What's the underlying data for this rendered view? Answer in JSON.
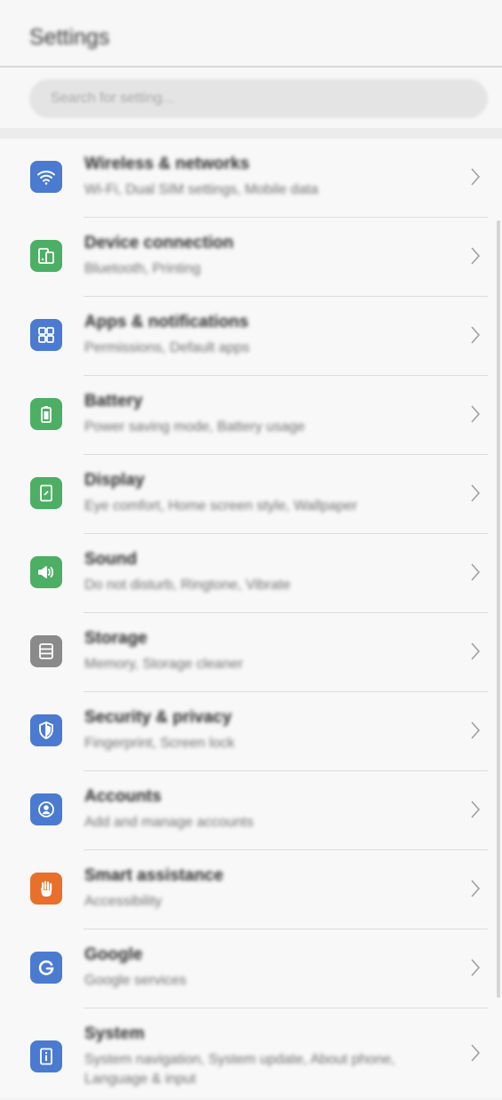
{
  "header": {
    "title": "Settings"
  },
  "search": {
    "placeholder": "Search for setting..."
  },
  "items": [
    {
      "label": "Wireless & networks",
      "sub": "Wi-Fi, Dual SIM settings, Mobile data",
      "icon": "wifi-icon",
      "color": "#4a7bd0"
    },
    {
      "label": "Device connection",
      "sub": "Bluetooth, Printing",
      "icon": "device-connection-icon",
      "color": "#4caf64"
    },
    {
      "label": "Apps & notifications",
      "sub": "Permissions, Default apps",
      "icon": "apps-grid-icon",
      "color": "#4a7bd0"
    },
    {
      "label": "Battery",
      "sub": "Power saving mode, Battery usage",
      "icon": "battery-icon",
      "color": "#4caf64"
    },
    {
      "label": "Display",
      "sub": "Eye comfort, Home screen style, Wallpaper",
      "icon": "display-icon",
      "color": "#4caf64"
    },
    {
      "label": "Sound",
      "sub": "Do not disturb, Ringtone, Vibrate",
      "icon": "speaker-icon",
      "color": "#4caf64"
    },
    {
      "label": "Storage",
      "sub": "Memory, Storage cleaner",
      "icon": "storage-icon",
      "color": "#8a8a8a"
    },
    {
      "label": "Security & privacy",
      "sub": "Fingerprint, Screen lock",
      "icon": "shield-icon",
      "color": "#4a7bd0"
    },
    {
      "label": "Accounts",
      "sub": "Add and manage accounts",
      "icon": "account-icon",
      "color": "#4a7bd0"
    },
    {
      "label": "Smart assistance",
      "sub": "Accessibility",
      "icon": "hand-icon",
      "color": "#e8702a"
    },
    {
      "label": "Google",
      "sub": "Google services",
      "icon": "google-icon",
      "color": "#4a7bd0"
    },
    {
      "label": "System",
      "sub": "System navigation, System update, About phone, Language & input",
      "icon": "info-icon",
      "color": "#4a7bd0"
    }
  ]
}
